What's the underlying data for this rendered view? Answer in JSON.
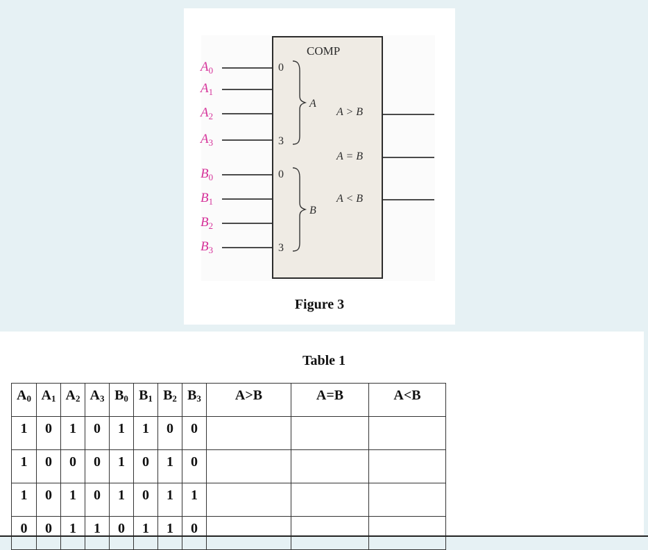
{
  "figure": {
    "block_title": "COMP",
    "caption": "Figure 3",
    "inputs_a": [
      {
        "letter": "A",
        "sub": "0"
      },
      {
        "letter": "A",
        "sub": "1"
      },
      {
        "letter": "A",
        "sub": "2"
      },
      {
        "letter": "A",
        "sub": "3"
      }
    ],
    "inputs_b": [
      {
        "letter": "B",
        "sub": "0"
      },
      {
        "letter": "B",
        "sub": "1"
      },
      {
        "letter": "B",
        "sub": "2"
      },
      {
        "letter": "B",
        "sub": "3"
      }
    ],
    "group_a": {
      "start": "0",
      "end": "3",
      "name": "A"
    },
    "group_b": {
      "start": "0",
      "end": "3",
      "name": "B"
    },
    "outputs": [
      "A > B",
      "A = B",
      "A < B"
    ],
    "colors": {
      "input_label": "#d6339a",
      "block_fill": "#efebe4",
      "block_border": "#2b2b2b"
    }
  },
  "table": {
    "title": "Table 1",
    "headers": [
      {
        "letter": "A",
        "sub": "0"
      },
      {
        "letter": "A",
        "sub": "1"
      },
      {
        "letter": "A",
        "sub": "2"
      },
      {
        "letter": "A",
        "sub": "3"
      },
      {
        "letter": "B",
        "sub": "0"
      },
      {
        "letter": "B",
        "sub": "1"
      },
      {
        "letter": "B",
        "sub": "2"
      },
      {
        "letter": "B",
        "sub": "3"
      },
      {
        "letter": "A>B",
        "sub": ""
      },
      {
        "letter": "A=B",
        "sub": ""
      },
      {
        "letter": "A<B",
        "sub": ""
      }
    ],
    "rows": [
      [
        "1",
        "0",
        "1",
        "0",
        "1",
        "1",
        "0",
        "0",
        "",
        "",
        ""
      ],
      [
        "1",
        "0",
        "0",
        "0",
        "1",
        "0",
        "1",
        "0",
        "",
        "",
        ""
      ],
      [
        "1",
        "0",
        "1",
        "0",
        "1",
        "0",
        "1",
        "1",
        "",
        "",
        ""
      ],
      [
        "0",
        "0",
        "1",
        "1",
        "0",
        "1",
        "1",
        "0",
        "",
        "",
        ""
      ]
    ]
  }
}
